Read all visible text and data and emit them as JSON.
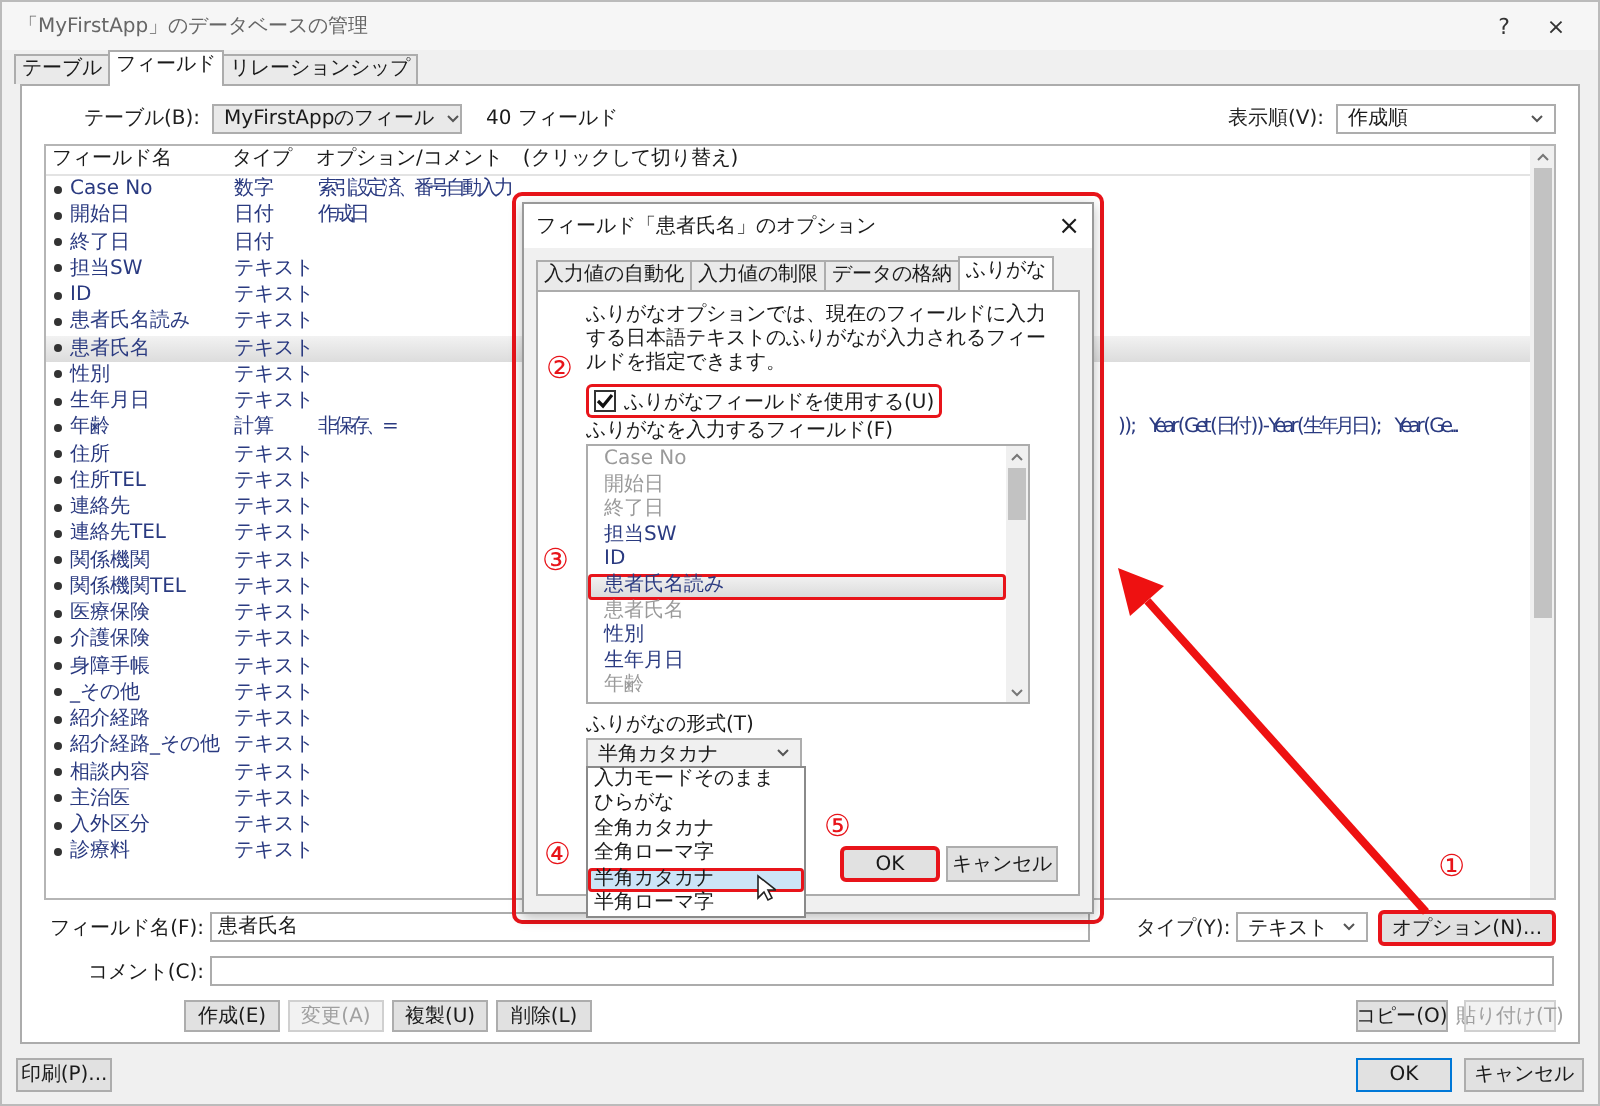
{
  "window": {
    "title": "「MyFirstApp」のデータベースの管理",
    "help": "?",
    "close": "×"
  },
  "tabs": [
    {
      "label": "テーブル",
      "selected": false
    },
    {
      "label": "フィールド",
      "selected": true
    },
    {
      "label": "リレーションシップ",
      "selected": false
    }
  ],
  "table_picker": {
    "label": "テーブル(B):",
    "value": "MyFirstAppのフィール",
    "count": "40 フィールド"
  },
  "sort_order": {
    "label": "表示順(V):",
    "value": "作成順"
  },
  "field_list": {
    "columns": [
      "フィールド名",
      "タイプ",
      "オプション/コメント　(クリックして切り替え)"
    ],
    "rows": [
      {
        "name": "Case No",
        "type": "数字",
        "options": [
          "索引設定済、番号自動入力"
        ],
        "selected": false
      },
      {
        "name": "開始日",
        "type": "日付",
        "options": [
          "作成日"
        ],
        "selected": false
      },
      {
        "name": "終了日",
        "type": "日付",
        "options": [],
        "selected": false
      },
      {
        "name": "担当SW",
        "type": "テキスト",
        "options": [],
        "selected": false
      },
      {
        "name": "ID",
        "type": "テキスト",
        "options": [],
        "selected": false
      },
      {
        "name": "患者氏名読み",
        "type": "テキスト",
        "options": [],
        "selected": false
      },
      {
        "name": "患者氏名",
        "type": "テキスト",
        "options": [],
        "selected": true
      },
      {
        "name": "性別",
        "type": "テキスト",
        "options": [],
        "selected": false
      },
      {
        "name": "生年月日",
        "type": "テキスト",
        "options": [],
        "selected": false
      },
      {
        "name": "年齢",
        "type": "計算",
        "options": [
          "非保存、=",
          ") ) ;",
          "Year ( Get ( 日付 ) ) - Year ( 生年月日 ) ;",
          "Year ( Ge..."
        ],
        "selected": false
      },
      {
        "name": "住所",
        "type": "テキスト",
        "options": [],
        "selected": false
      },
      {
        "name": "住所TEL",
        "type": "テキスト",
        "options": [],
        "selected": false
      },
      {
        "name": "連絡先",
        "type": "テキスト",
        "options": [],
        "selected": false
      },
      {
        "name": "連絡先TEL",
        "type": "テキスト",
        "options": [],
        "selected": false
      },
      {
        "name": "関係機関",
        "type": "テキスト",
        "options": [],
        "selected": false
      },
      {
        "name": "関係機関TEL",
        "type": "テキスト",
        "options": [],
        "selected": false
      },
      {
        "name": "医療保険",
        "type": "テキスト",
        "options": [],
        "selected": false
      },
      {
        "name": "介護保険",
        "type": "テキスト",
        "options": [],
        "selected": false
      },
      {
        "name": "身障手帳",
        "type": "テキスト",
        "options": [],
        "selected": false
      },
      {
        "name": "_その他",
        "type": "テキスト",
        "options": [],
        "selected": false
      },
      {
        "name": "紹介経路",
        "type": "テキスト",
        "options": [],
        "selected": false
      },
      {
        "name": "紹介経路_その他",
        "type": "テキスト",
        "options": [],
        "selected": false
      },
      {
        "name": "相談内容",
        "type": "テキスト",
        "options": [],
        "selected": false
      },
      {
        "name": "主治医",
        "type": "テキスト",
        "options": [],
        "selected": false
      },
      {
        "name": "入外区分",
        "type": "テキスト",
        "options": [],
        "selected": false
      },
      {
        "name": "診療料",
        "type": "テキスト",
        "options": [],
        "selected": false
      }
    ]
  },
  "field_form": {
    "name_label": "フィールド名(F):",
    "name_value": "患者氏名",
    "type_label": "タイプ(Y):",
    "type_value": "テキスト",
    "options_button": {
      "label": "オプション(N)...",
      "highlighted": true,
      "step": "①"
    },
    "comment_label": "コメント(C):"
  },
  "actions": [
    {
      "label": "作成(E)",
      "disabled": false
    },
    {
      "label": "変更(A)",
      "disabled": true
    },
    {
      "label": "複製(U)",
      "disabled": false
    },
    {
      "label": "削除(L)",
      "disabled": false
    }
  ],
  "clipboard": [
    {
      "label": "コピー(O)",
      "disabled": false
    },
    {
      "label": "貼り付け(T)",
      "disabled": true
    }
  ],
  "footer": {
    "print": "印刷(P)...",
    "buttons": [
      {
        "label": "OK",
        "default": true
      },
      {
        "label": "キャンセル",
        "default": false
      }
    ]
  },
  "pointer_arrow": true,
  "options_dialog": {
    "highlighted": true,
    "title": "フィールド「患者氏名」のオプション",
    "close": "×",
    "tabs": [
      {
        "label": "入力値の自動化",
        "selected": false
      },
      {
        "label": "入力値の制限",
        "selected": false
      },
      {
        "label": "データの格納",
        "selected": false
      },
      {
        "label": "ふりがな",
        "selected": true
      }
    ],
    "description": "ふりがなオプションでは、現在のフィールドに入力する日本語テキストのふりがなが入力されるフィールドを指定できます。",
    "use_furigana": {
      "label": "ふりがなフィールドを使用する(U)",
      "checked": true,
      "highlighted": true,
      "step": "②"
    },
    "list_label": "ふりがなを入力するフィールド(F)",
    "list_step": "③",
    "list_items": [
      {
        "label": "Case No",
        "enabled": false,
        "selected": false,
        "highlighted": false
      },
      {
        "label": "開始日",
        "enabled": false,
        "selected": false,
        "highlighted": false
      },
      {
        "label": "終了日",
        "enabled": false,
        "selected": false,
        "highlighted": false
      },
      {
        "label": "担当SW",
        "enabled": true,
        "selected": false,
        "highlighted": false
      },
      {
        "label": "ID",
        "enabled": true,
        "selected": false,
        "highlighted": false
      },
      {
        "label": "患者氏名読み",
        "enabled": true,
        "selected": true,
        "highlighted": true
      },
      {
        "label": "患者氏名",
        "enabled": false,
        "selected": false,
        "highlighted": false
      },
      {
        "label": "性別",
        "enabled": true,
        "selected": false,
        "highlighted": false
      },
      {
        "label": "生年月日",
        "enabled": true,
        "selected": false,
        "highlighted": false
      },
      {
        "label": "年齢",
        "enabled": false,
        "selected": false,
        "highlighted": false
      }
    ],
    "format_label": "ふりがなの形式(T)",
    "format_value": "半角カタカナ",
    "format_step": "④",
    "format_options": [
      {
        "label": "入力モードそのまま",
        "selected": false,
        "highlighted": false
      },
      {
        "label": "ひらがな",
        "selected": false,
        "highlighted": false
      },
      {
        "label": "全角カタカナ",
        "selected": false,
        "highlighted": false
      },
      {
        "label": "全角ローマ字",
        "selected": false,
        "highlighted": false
      },
      {
        "label": "半角カタカナ",
        "selected": true,
        "highlighted": true
      },
      {
        "label": "半角ローマ字",
        "selected": false,
        "highlighted": false
      }
    ],
    "buttons": [
      {
        "label": "OK",
        "default": true,
        "highlighted": true,
        "step": "⑤"
      },
      {
        "label": "キャンセル",
        "default": false,
        "highlighted": false
      }
    ]
  }
}
